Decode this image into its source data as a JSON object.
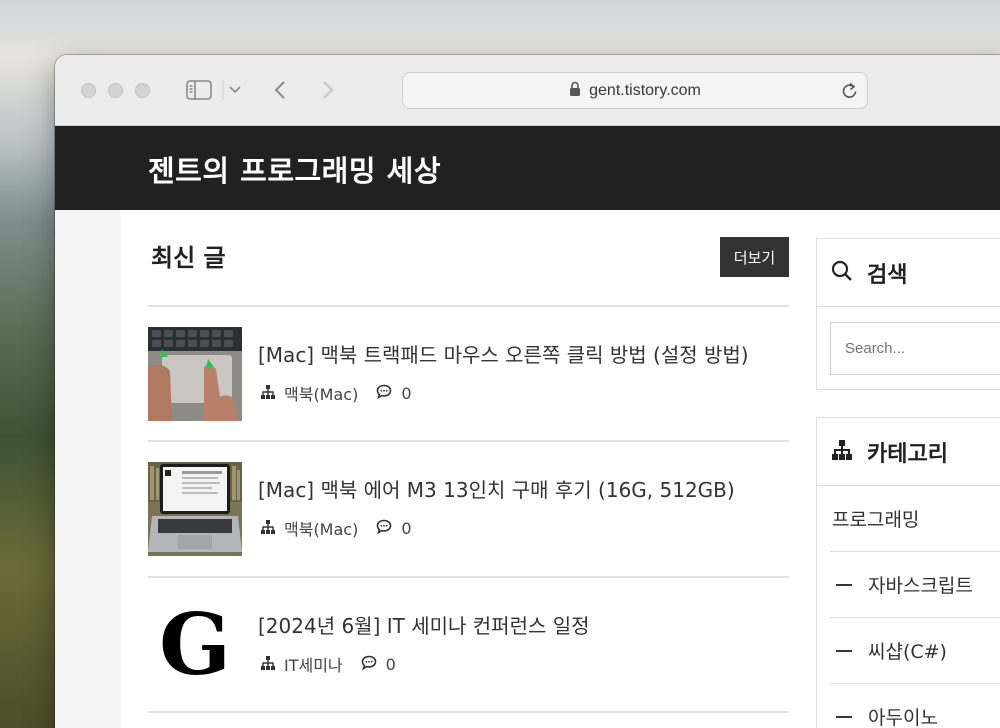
{
  "browser": {
    "url": "gent.tistory.com"
  },
  "blog": {
    "title": "젠트의 프로그래밍 세상"
  },
  "recent": {
    "heading": "최신 글",
    "more_label": "더보기",
    "posts": [
      {
        "title": "[Mac] 맥북 트랙패드 마우스 오른쪽 클릭 방법 (설정 방법)",
        "category": "맥북(Mac)",
        "comments": "0"
      },
      {
        "title": "[Mac] 맥북 에어 M3 13인치 구매 후기 (16G, 512GB)",
        "category": "맥북(Mac)",
        "comments": "0"
      },
      {
        "title": "[2024년 6월] IT 세미나 컨퍼런스 일정",
        "category": "IT세미나",
        "comments": "0",
        "thumb_letter": "G"
      }
    ]
  },
  "sidebar": {
    "search": {
      "title": "검색",
      "placeholder": "Search..."
    },
    "category": {
      "title": "카테고리",
      "items": [
        {
          "label": "프로그래밍"
        },
        {
          "label": "자바스크립트"
        },
        {
          "label": "씨샵(C#)"
        },
        {
          "label": "아두이노"
        }
      ]
    }
  },
  "icons": {
    "category": "category-tree-icon",
    "comment": "comment-bubble-icon",
    "search": "search-icon",
    "lock": "lock-icon",
    "reload": "reload-icon",
    "sidebar": "sidebar-toggle-icon",
    "back": "chevron-left-icon",
    "forward": "chevron-right-icon"
  },
  "colors": {
    "header_bg": "#212121",
    "more_btn_bg": "#333333",
    "page_bg": "#f5f5f5"
  }
}
